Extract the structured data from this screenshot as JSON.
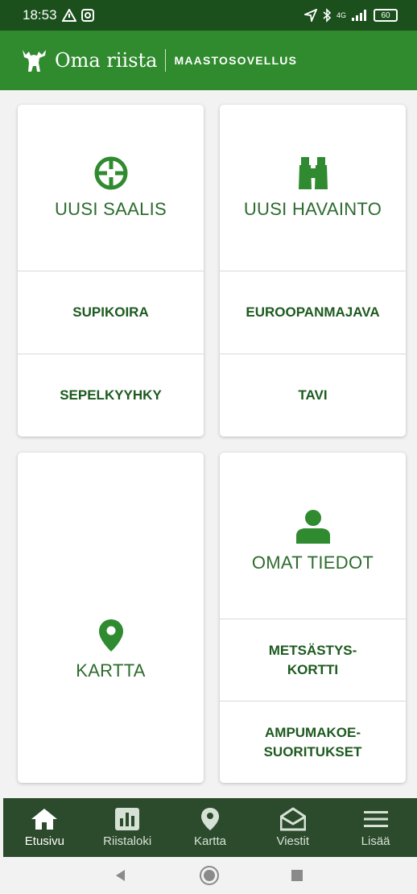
{
  "status": {
    "time": "18:53",
    "network": "4G",
    "battery": "60"
  },
  "app": {
    "brand": "Oma riista",
    "subtitle": "MAASTOSOVELLUS"
  },
  "cards": {
    "catch": {
      "title": "UUSI SAALIS",
      "items": [
        "SUPIKOIRA",
        "SEPELKYYHKY"
      ]
    },
    "observation": {
      "title": "UUSI HAVAINTO",
      "items": [
        "EUROOPANMAJAVA",
        "TAVI"
      ]
    },
    "map": {
      "title": "KARTTA"
    },
    "profile": {
      "title": "OMAT TIEDOT",
      "items": [
        "METSÄSTYS-\nKORTTI",
        "AMPUMAKOE-\nSUORITUKSET"
      ]
    }
  },
  "nav": {
    "items": [
      {
        "label": "Etusivu",
        "icon": "home-icon"
      },
      {
        "label": "Riistaloki",
        "icon": "bar-chart-icon"
      },
      {
        "label": "Kartta",
        "icon": "map-pin-icon"
      },
      {
        "label": "Viestit",
        "icon": "mail-icon"
      },
      {
        "label": "Lisää",
        "icon": "menu-icon"
      }
    ]
  },
  "colors": {
    "statusbar": "#1b4f1c",
    "appbar": "#308a2e",
    "accent": "#2f8a30",
    "bottomnav": "#2c4a2c"
  }
}
